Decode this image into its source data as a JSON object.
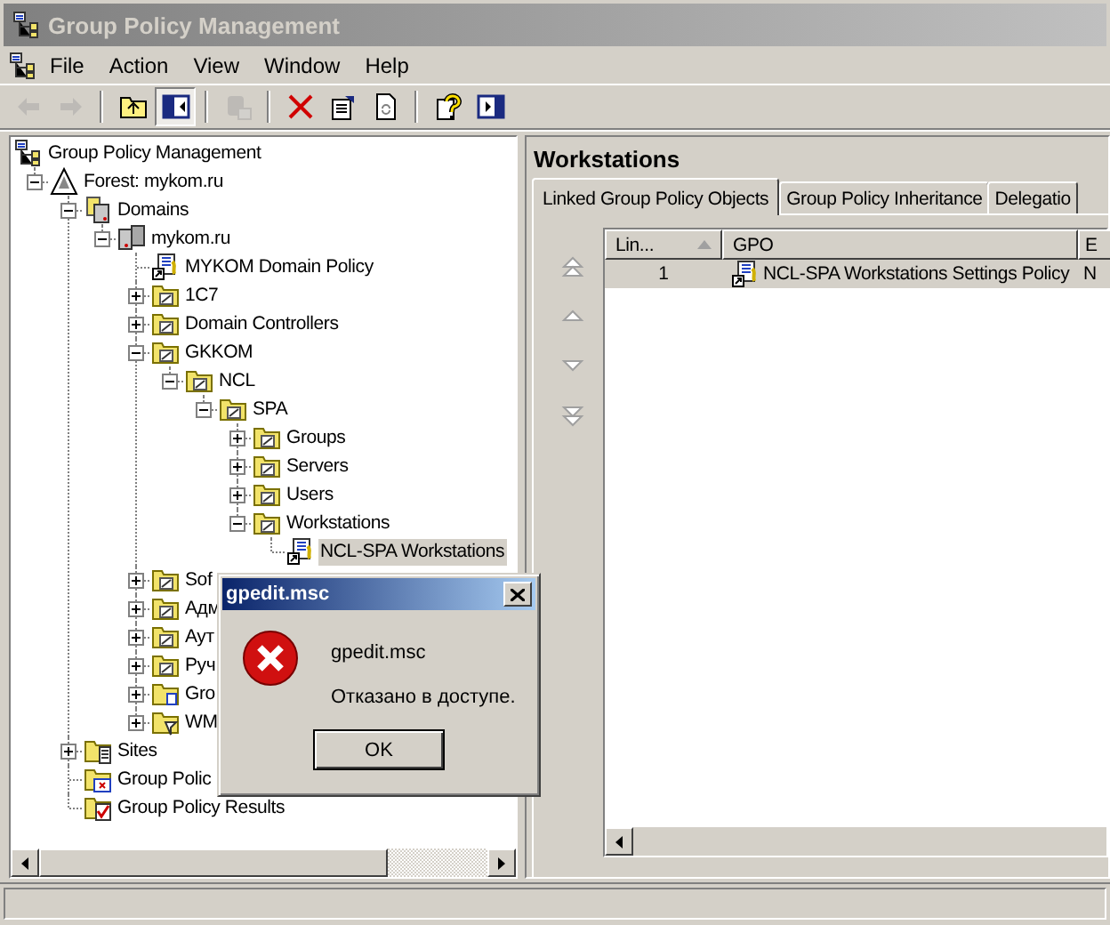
{
  "window": {
    "title": "Group Policy Management"
  },
  "menu": [
    "File",
    "Action",
    "View",
    "Window",
    "Help"
  ],
  "toolbar": [
    {
      "kind": "back",
      "disabled": true,
      "pressed": false
    },
    {
      "kind": "forward",
      "disabled": true,
      "pressed": false
    },
    {
      "kind": "separator"
    },
    {
      "kind": "up-folder",
      "disabled": false,
      "pressed": false
    },
    {
      "kind": "show-tree",
      "disabled": false,
      "pressed": true
    },
    {
      "kind": "separator"
    },
    {
      "kind": "export",
      "disabled": true,
      "pressed": false
    },
    {
      "kind": "separator"
    },
    {
      "kind": "delete",
      "disabled": false,
      "pressed": false
    },
    {
      "kind": "properties",
      "disabled": false,
      "pressed": false
    },
    {
      "kind": "refresh",
      "disabled": false,
      "pressed": false
    },
    {
      "kind": "separator"
    },
    {
      "kind": "help",
      "disabled": false,
      "pressed": false
    },
    {
      "kind": "show-action-pane",
      "disabled": false,
      "pressed": false
    }
  ],
  "tree": {
    "root": {
      "label": "Group Policy Management",
      "kind": "console",
      "selected": false
    },
    "items": [
      {
        "label": "Forest: mykom.ru",
        "kind": "forest",
        "expanded": true,
        "selected": false,
        "children": [
          {
            "label": "Domains",
            "kind": "domains",
            "expanded": true,
            "selected": false,
            "children": [
              {
                "label": "mykom.ru",
                "kind": "domain",
                "expanded": true,
                "selected": false,
                "children": [
                  {
                    "label": "MYKOM Domain Policy",
                    "kind": "gpo-link",
                    "selected": false
                  },
                  {
                    "label": "1C7",
                    "kind": "ou",
                    "expanded": false,
                    "selected": false
                  },
                  {
                    "label": "Domain Controllers",
                    "kind": "ou",
                    "expanded": false,
                    "selected": false
                  },
                  {
                    "label": "GKKOM",
                    "kind": "ou",
                    "expanded": true,
                    "selected": false,
                    "children": [
                      {
                        "label": "NCL",
                        "kind": "ou",
                        "expanded": true,
                        "selected": false,
                        "children": [
                          {
                            "label": "SPA",
                            "kind": "ou",
                            "expanded": true,
                            "selected": false,
                            "children": [
                              {
                                "label": "Groups",
                                "kind": "ou",
                                "expanded": false,
                                "selected": false
                              },
                              {
                                "label": "Servers",
                                "kind": "ou",
                                "expanded": false,
                                "selected": false
                              },
                              {
                                "label": "Users",
                                "kind": "ou",
                                "expanded": false,
                                "selected": false
                              },
                              {
                                "label": "Workstations",
                                "kind": "ou",
                                "expanded": true,
                                "selected": false,
                                "children": [
                                  {
                                    "label": "NCL-SPA Workstations",
                                    "kind": "gpo-link",
                                    "selected": true
                                  }
                                ]
                              }
                            ]
                          }
                        ]
                      }
                    ]
                  },
                  {
                    "label": "Sof",
                    "kind": "ou",
                    "expanded": false,
                    "selected": false
                  },
                  {
                    "label": "Адм",
                    "kind": "ou",
                    "expanded": false,
                    "selected": false
                  },
                  {
                    "label": "Аут",
                    "kind": "ou",
                    "expanded": false,
                    "selected": false
                  },
                  {
                    "label": "Руч",
                    "kind": "ou",
                    "expanded": false,
                    "selected": false
                  },
                  {
                    "label": "Gro",
                    "kind": "gpo-container",
                    "expanded": false,
                    "selected": false
                  },
                  {
                    "label": "WM",
                    "kind": "wmi-filters",
                    "expanded": false,
                    "selected": false
                  }
                ]
              }
            ]
          },
          {
            "label": "Sites",
            "kind": "sites",
            "expanded": false,
            "selected": false
          },
          {
            "label": "Group Polic",
            "kind": "modeling",
            "selected": false
          },
          {
            "label": "Group Policy Results",
            "kind": "results",
            "selected": false
          }
        ]
      }
    ]
  },
  "details": {
    "heading": "Workstations",
    "tabs": [
      {
        "label": "Linked Group Policy Objects",
        "selected": true
      },
      {
        "label": "Group Policy Inheritance",
        "selected": false
      },
      {
        "label": "Delegatio",
        "selected": false
      }
    ],
    "order_buttons": [
      {
        "kind": "top",
        "disabled": true
      },
      {
        "kind": "up",
        "disabled": true
      },
      {
        "kind": "down",
        "disabled": true
      },
      {
        "kind": "bottom",
        "disabled": true
      }
    ],
    "table": {
      "columns": [
        {
          "label": "Lin...",
          "sorted": true
        },
        {
          "label": "GPO"
        },
        {
          "label": "E"
        }
      ],
      "rows": [
        {
          "cells": [
            "1",
            "NCL-SPA Workstations Settings Policy",
            "N"
          ],
          "selected": true
        }
      ]
    }
  },
  "dialog": {
    "title": "gpedit.msc",
    "kind": "error",
    "heading": "gpedit.msc",
    "message": "Отказано в доступе.",
    "buttons": [
      "OK"
    ]
  }
}
